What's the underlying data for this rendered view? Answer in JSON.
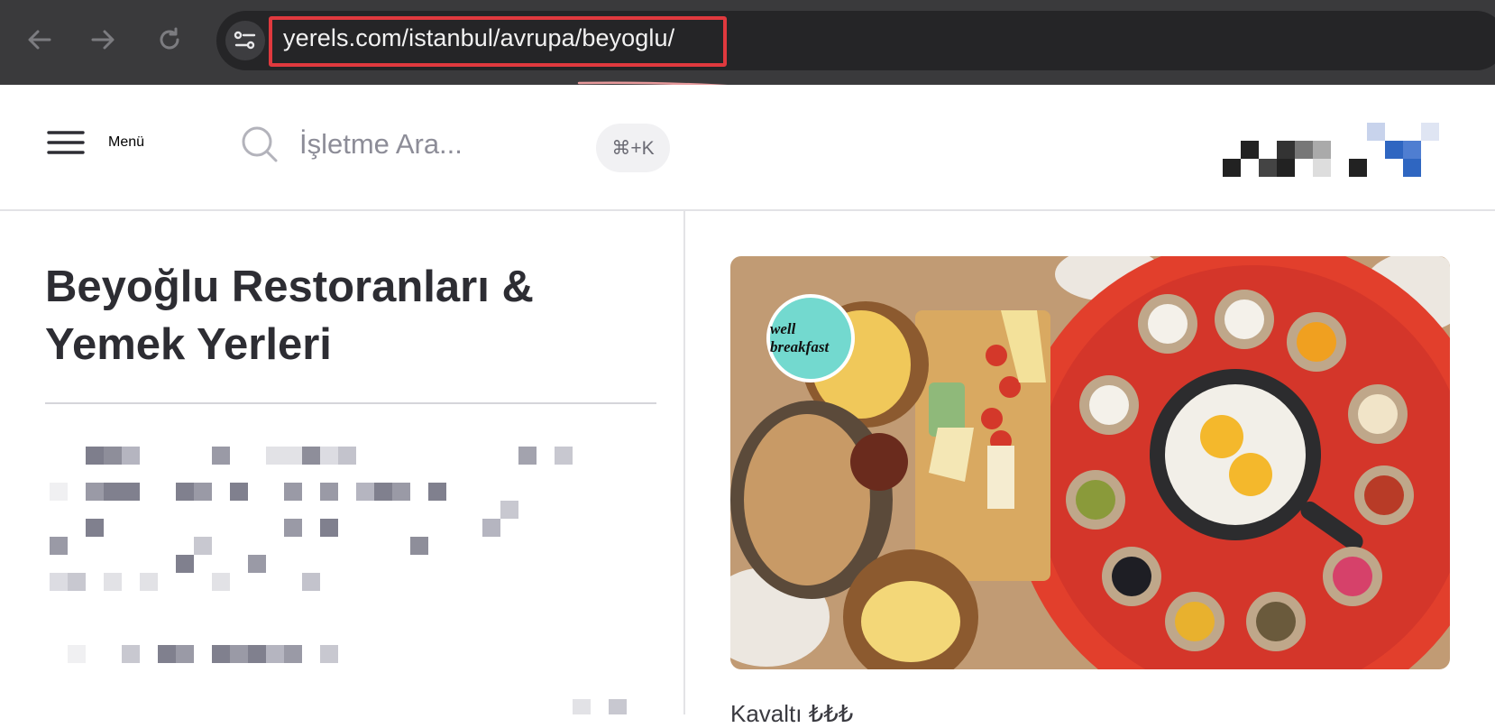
{
  "browser": {
    "url": "yerels.com/istanbul/avrupa/beyoglu/",
    "back_icon": "arrow-left-icon",
    "forward_icon": "arrow-right-icon",
    "reload_icon": "reload-icon",
    "site_info_icon": "tune-icon",
    "highlight_color": "#e0393e"
  },
  "header": {
    "menu_label": "Menü",
    "search_placeholder": "İşletme Ara...",
    "shortcut": "⌘+K"
  },
  "page": {
    "title": "Beyoğlu Restoranları & Yemek Yerleri"
  },
  "featured": {
    "badge_text": "well breakfast",
    "price_label": "Kavaltı ₺₺₺"
  }
}
